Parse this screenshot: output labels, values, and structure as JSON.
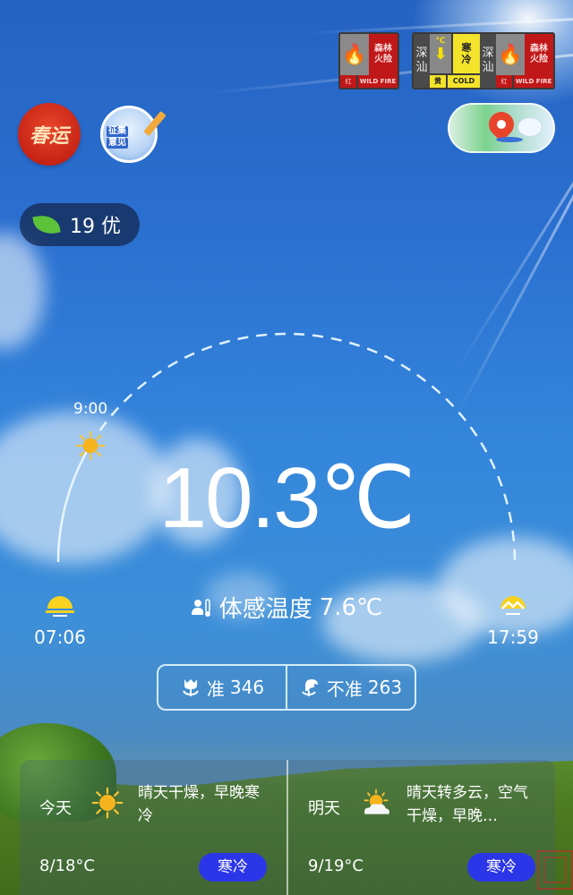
{
  "alerts": [
    {
      "type": "fire",
      "title_line1": "森林",
      "title_line2": "火险",
      "level": "红",
      "label_en": "WILD FIRE"
    },
    {
      "type": "cold",
      "city_line1": "深",
      "city_line2": "汕",
      "unit": "℃",
      "title_line1": "寒",
      "title_line2": "冷",
      "level": "黄",
      "label_en": "COLD"
    },
    {
      "type": "fire",
      "city_line1": "深",
      "city_line2": "汕",
      "title_line1": "森林",
      "title_line2": "火险",
      "level": "红",
      "label_en": "WILD FIRE"
    }
  ],
  "top_icons": {
    "spring_festival": "春运",
    "feedback_line1": "征集",
    "feedback_line2": "意见"
  },
  "aqi": {
    "value": "19",
    "level": "优"
  },
  "sun_arc": {
    "current_time_label": "9:00",
    "progress": 0.17
  },
  "current": {
    "temperature": "10.3℃",
    "feels_like_label": "体感温度",
    "feels_like_value": "7.6℃",
    "sunrise": "07:06",
    "sunset": "17:59"
  },
  "votes": {
    "accurate_label": "准",
    "accurate_count": "346",
    "inaccurate_label": "不准",
    "inaccurate_count": "263"
  },
  "forecast": [
    {
      "day": "今天",
      "icon": "sunny",
      "desc": "晴天干燥，早晚寒冷",
      "temp": "8/18°C",
      "badge": "寒冷"
    },
    {
      "day": "明天",
      "icon": "partly-cloudy",
      "desc": "晴天转多云，空气干燥，早晚…",
      "temp": "9/19°C",
      "badge": "寒冷"
    }
  ]
}
